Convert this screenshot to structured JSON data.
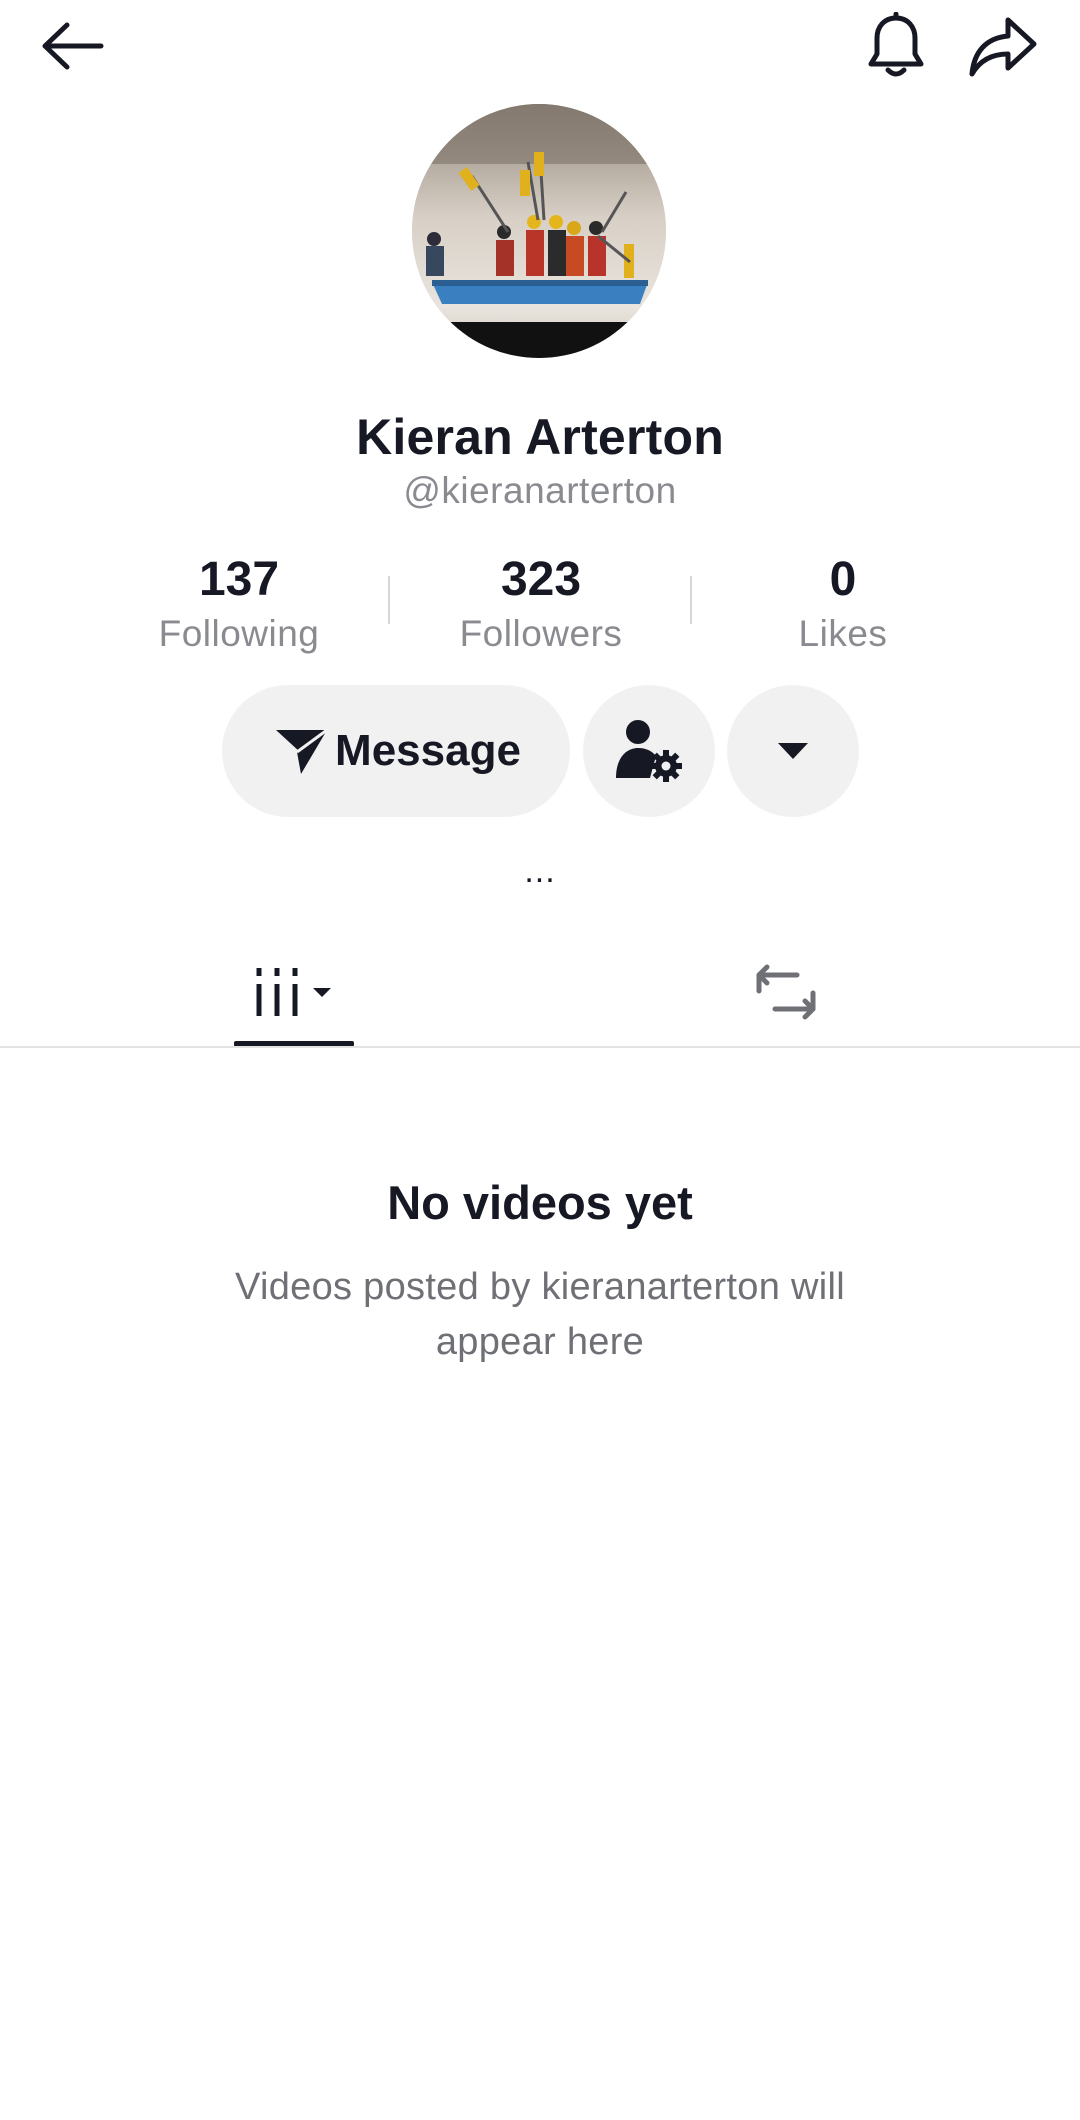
{
  "header": {
    "back_icon": "arrow-left-icon",
    "notifications_icon": "bell-icon",
    "share_icon": "share-arrow-icon"
  },
  "profile": {
    "avatar_icon": "avatar-photo-rafting",
    "display_name": "Kieran Arterton",
    "username": "@kieranarterton",
    "more_indicator": "..."
  },
  "stats": [
    {
      "value": "137",
      "label": "Following"
    },
    {
      "value": "323",
      "label": "Followers"
    },
    {
      "value": "0",
      "label": "Likes"
    }
  ],
  "actions": {
    "message_label": "Message",
    "message_icon": "send-icon",
    "friend_settings_icon": "person-gear-icon",
    "more_dropdown_icon": "triangle-down-icon"
  },
  "tabs": [
    {
      "name": "videos",
      "icon": "grid-videos-icon",
      "selected": true
    },
    {
      "name": "reposts",
      "icon": "repost-icon",
      "selected": false
    }
  ],
  "empty_state": {
    "title": "No videos yet",
    "subtitle": "Videos posted by kieranarterton will appear here"
  },
  "colors": {
    "primary_text": "#161823",
    "secondary_text": "#8a8b91",
    "button_bg": "#f1f1f2",
    "divider": "#e3e3e4"
  }
}
